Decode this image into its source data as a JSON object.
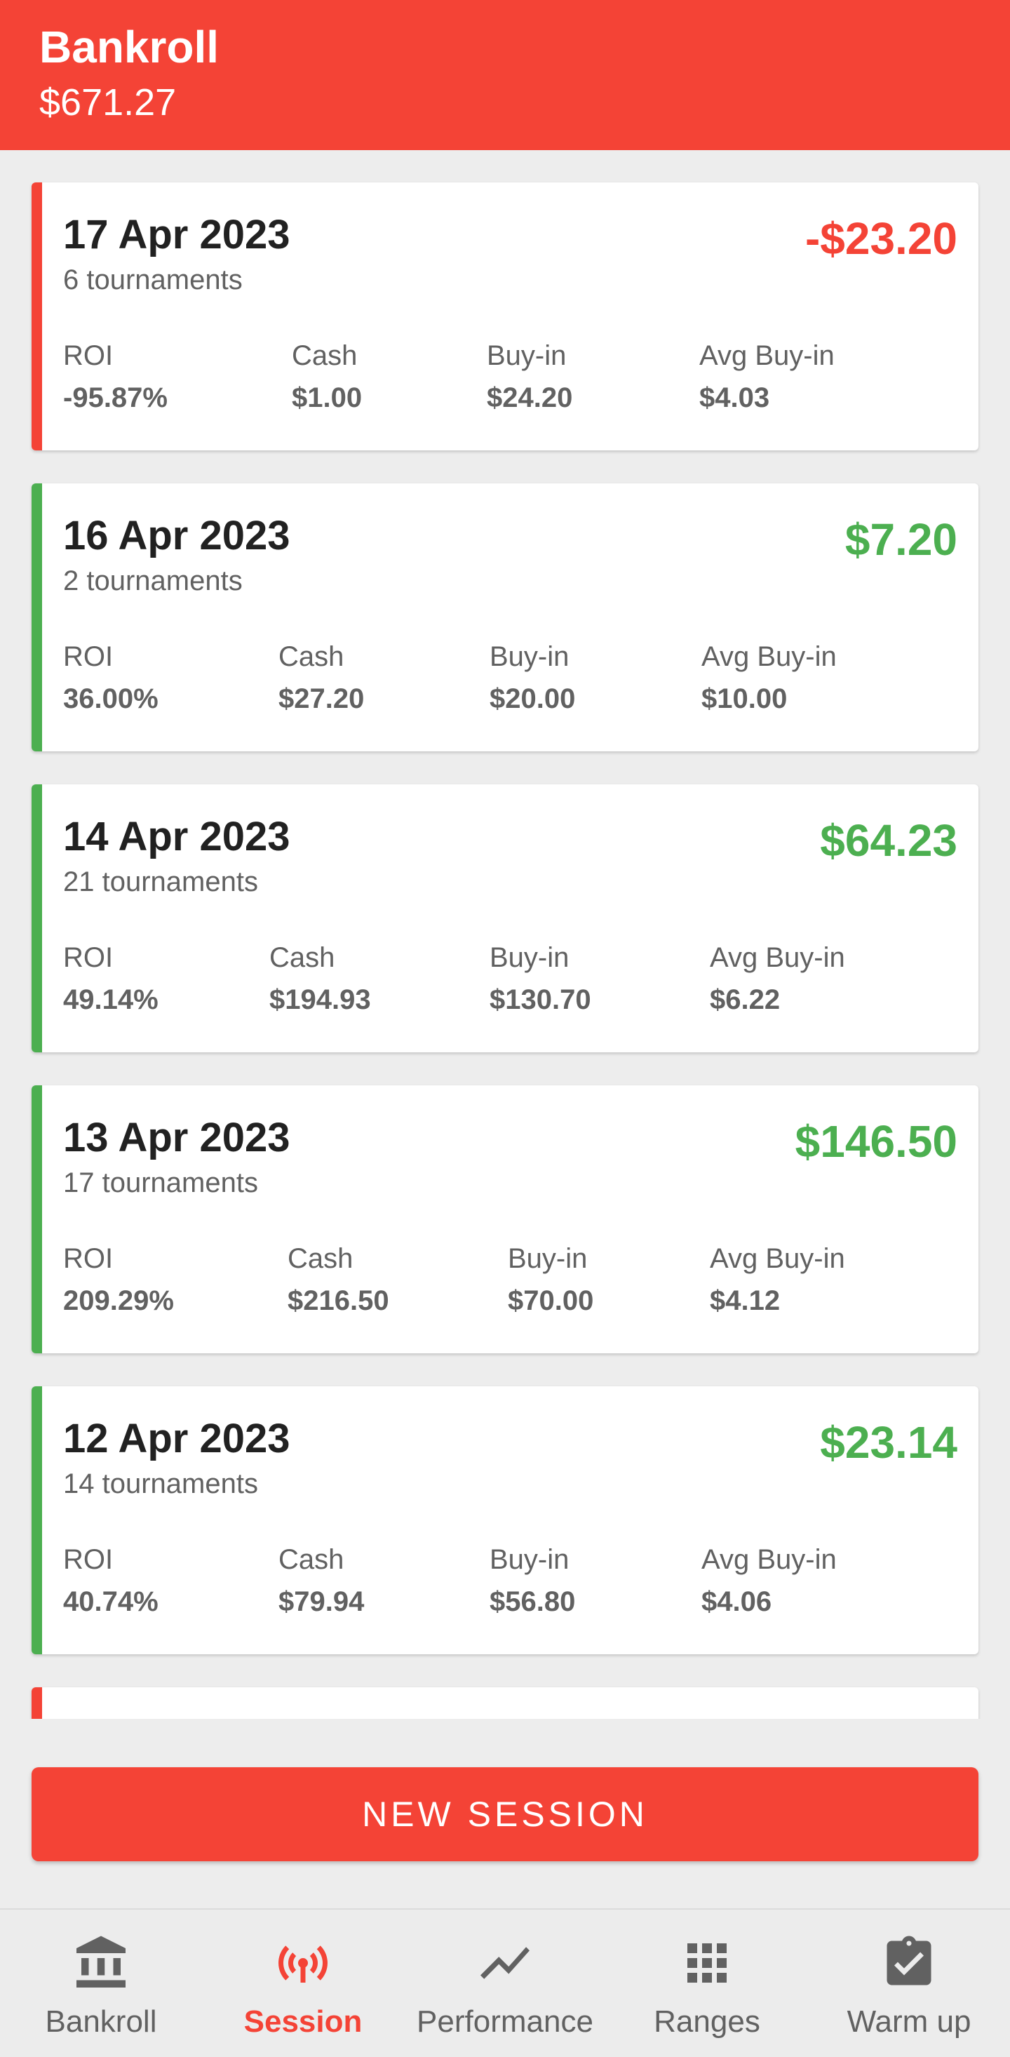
{
  "header": {
    "title": "Bankroll",
    "amount": "$671.27"
  },
  "colors": {
    "accent": "#f44336",
    "positive": "#4caf50",
    "negative": "#f44336"
  },
  "sessions": [
    {
      "date": "17 Apr 2023",
      "tournaments": "6 tournaments",
      "profit": "-$23.20",
      "result": "loss",
      "roi_label": "ROI",
      "roi": "-95.87%",
      "cash_label": "Cash",
      "cash": "$1.00",
      "buyin_label": "Buy-in",
      "buyin": "$24.20",
      "avg_label": "Avg Buy-in",
      "avg": "$4.03"
    },
    {
      "date": "16 Apr 2023",
      "tournaments": "2 tournaments",
      "profit": "$7.20",
      "result": "win",
      "roi_label": "ROI",
      "roi": "36.00%",
      "cash_label": "Cash",
      "cash": "$27.20",
      "buyin_label": "Buy-in",
      "buyin": "$20.00",
      "avg_label": "Avg Buy-in",
      "avg": "$10.00"
    },
    {
      "date": "14 Apr 2023",
      "tournaments": "21 tournaments",
      "profit": "$64.23",
      "result": "win",
      "roi_label": "ROI",
      "roi": "49.14%",
      "cash_label": "Cash",
      "cash": "$194.93",
      "buyin_label": "Buy-in",
      "buyin": "$130.70",
      "avg_label": "Avg Buy-in",
      "avg": "$6.22"
    },
    {
      "date": "13 Apr 2023",
      "tournaments": "17 tournaments",
      "profit": "$146.50",
      "result": "win",
      "roi_label": "ROI",
      "roi": "209.29%",
      "cash_label": "Cash",
      "cash": "$216.50",
      "buyin_label": "Buy-in",
      "buyin": "$70.00",
      "avg_label": "Avg Buy-in",
      "avg": "$4.12"
    },
    {
      "date": "12 Apr 2023",
      "tournaments": "14 tournaments",
      "profit": "$23.14",
      "result": "win",
      "roi_label": "ROI",
      "roi": "40.74%",
      "cash_label": "Cash",
      "cash": "$79.94",
      "buyin_label": "Buy-in",
      "buyin": "$56.80",
      "avg_label": "Avg Buy-in",
      "avg": "$4.06"
    }
  ],
  "new_session_label": "NEW SESSION",
  "nav": [
    {
      "label": "Bankroll",
      "icon": "bank-icon",
      "active": false
    },
    {
      "label": "Session",
      "icon": "broadcast-icon",
      "active": true
    },
    {
      "label": "Performance",
      "icon": "trending-line-icon",
      "active": false
    },
    {
      "label": "Ranges",
      "icon": "grid-icon",
      "active": false
    },
    {
      "label": "Warm up",
      "icon": "clipboard-check-icon",
      "active": false
    }
  ]
}
